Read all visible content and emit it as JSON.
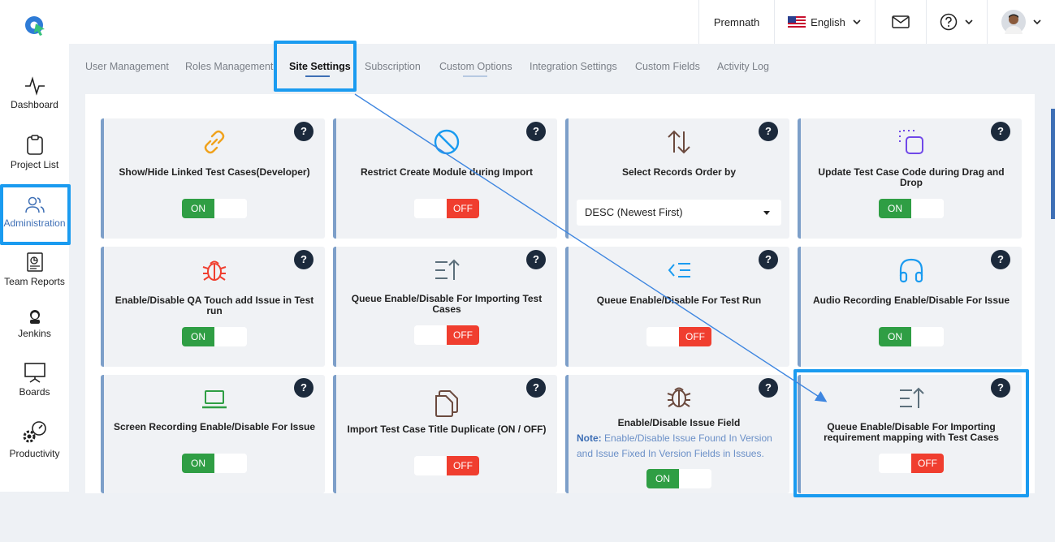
{
  "topbar": {
    "user_name": "Premnath",
    "language": "English",
    "mail_icon": "mail-icon",
    "help_icon": "help-circle-icon"
  },
  "sidebar": {
    "items": [
      {
        "label": "Dashboard",
        "icon": "activity-icon"
      },
      {
        "label": "Project List",
        "icon": "clipboard-icon"
      },
      {
        "label": "Administration",
        "icon": "users-icon"
      },
      {
        "label": "Team Reports",
        "icon": "report-icon"
      },
      {
        "label": "Jenkins",
        "icon": "jenkins-icon"
      },
      {
        "label": "Boards",
        "icon": "board-icon"
      },
      {
        "label": "Productivity",
        "icon": "gear-gauge-icon"
      }
    ]
  },
  "tabs": [
    {
      "label": "User Management"
    },
    {
      "label": "Roles Management"
    },
    {
      "label": "Site Settings"
    },
    {
      "label": "Subscription"
    },
    {
      "label": "Custom Options"
    },
    {
      "label": "Integration Settings"
    },
    {
      "label": "Custom Fields"
    },
    {
      "label": "Activity Log"
    }
  ],
  "toggle_labels": {
    "on": "ON",
    "off": "OFF"
  },
  "help_label": "?",
  "cards": [
    {
      "title": "Show/Hide Linked Test Cases(Developer)",
      "icon": "link-icon",
      "state": "ON"
    },
    {
      "title": "Restrict Create Module during Import",
      "icon": "prohibited-icon",
      "state": "OFF"
    },
    {
      "title": "Select Records Order by",
      "icon": "sort-arrows-icon",
      "select_value": "DESC (Newest First)"
    },
    {
      "title": "Update Test Case Code during Drag and Drop",
      "icon": "drag-drop-icon",
      "state": "ON"
    },
    {
      "title": "Enable/Disable QA Touch add Issue in Test run",
      "icon": "bug-icon",
      "state": "ON"
    },
    {
      "title": "Queue Enable/Disable For Importing Test Cases",
      "icon": "list-upload-icon",
      "state": "OFF"
    },
    {
      "title": "Queue Enable/Disable For Test Run",
      "icon": "list-indent-icon",
      "state": "OFF"
    },
    {
      "title": "Audio Recording Enable/Disable For Issue",
      "icon": "headphones-icon",
      "state": "ON"
    },
    {
      "title": "Screen Recording Enable/Disable For Issue",
      "icon": "laptop-icon",
      "state": "ON"
    },
    {
      "title": "Import Test Case Title Duplicate (ON / OFF)",
      "icon": "copy-icon",
      "state": "OFF"
    },
    {
      "title": "Enable/Disable Issue Field",
      "icon": "bug-icon",
      "state": "ON",
      "note_label": "Note:",
      "note_text": "Enable/Disable Issue Found In Version and Issue Fixed In Version Fields in Issues."
    },
    {
      "title": "Queue Enable/Disable For Importing requirement mapping with Test Cases",
      "icon": "list-upload-icon",
      "state": "OFF"
    }
  ],
  "colors": {
    "on": "#2f9e44",
    "off": "#f03e2f",
    "accent": "#3e6fb5",
    "highlight": "#1a9bf0"
  }
}
